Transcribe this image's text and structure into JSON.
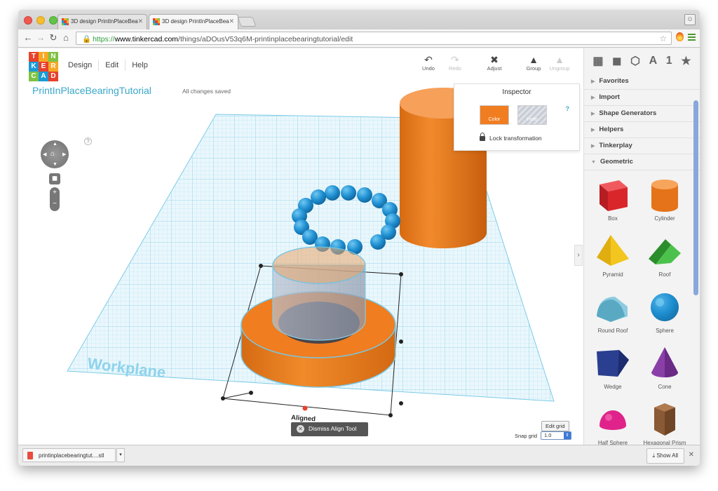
{
  "browser": {
    "tabs": [
      {
        "title": "3D design PrintInPlaceBea"
      },
      {
        "title": "3D design PrintInPlaceBea"
      }
    ],
    "url": {
      "scheme": "https://",
      "host": "www.tinkercad.com",
      "path": "/things/aDOusV53q6M-printinplacebearingtutorial/edit"
    }
  },
  "app": {
    "logo_letters": [
      "T",
      "I",
      "N",
      "K",
      "E",
      "R",
      "C",
      "A",
      "D"
    ],
    "menu": [
      "Design",
      "Edit",
      "Help"
    ],
    "design_title": "PrintInPlaceBearingTutorial",
    "save_status": "All changes saved",
    "tools": {
      "undo": "Undo",
      "redo": "Redo",
      "adjust": "Adjust",
      "group": "Group",
      "ungroup": "Ungroup"
    },
    "right_tab_labels": [
      "A",
      "1"
    ],
    "help_mark": "?"
  },
  "workspace": {
    "workplane_label": "Workplane",
    "align_label": "Aligned",
    "dismiss_label": "Dismiss Align Tool",
    "edit_grid": "Edit grid",
    "snap_label": "Snap grid",
    "snap_value": "1.0"
  },
  "inspector": {
    "title": "Inspector",
    "color_label": "Color",
    "hole_label": "Hole",
    "help": "?",
    "lock_label": "Lock transformation"
  },
  "panel": {
    "sections": [
      "Favorites",
      "Import",
      "Shape Generators",
      "Helpers",
      "Tinkerplay",
      "Geometric"
    ],
    "shapes": [
      {
        "label": "Box",
        "icon": "box-icon",
        "color": "#d9262b"
      },
      {
        "label": "Cylinder",
        "icon": "cylinder-icon",
        "color": "#f07d20"
      },
      {
        "label": "Pyramid",
        "icon": "pyramid-icon",
        "color": "#f2c61f"
      },
      {
        "label": "Roof",
        "icon": "roof-icon",
        "color": "#3bab3b"
      },
      {
        "label": "Round Roof",
        "icon": "round-roof-icon",
        "color": "#6fb6c9"
      },
      {
        "label": "Sphere",
        "icon": "sphere-icon",
        "color": "#1f8fd1"
      },
      {
        "label": "Wedge",
        "icon": "wedge-icon",
        "color": "#2a3f8f"
      },
      {
        "label": "Cone",
        "icon": "cone-icon",
        "color": "#8a3fa8"
      },
      {
        "label": "Half Sphere",
        "icon": "half-sphere-icon",
        "color": "#e0238a"
      },
      {
        "label": "Hexagonal Prism",
        "icon": "hexagonal-prism-icon",
        "color": "#8a5a36"
      }
    ]
  },
  "downloads": {
    "file": "printinplacebearingtut....stl",
    "show_all": "Show All"
  },
  "colors": {
    "accent": "#3aa7c9",
    "object_orange": "#f07d20",
    "ball_blue": "#1f8fd1",
    "grid_blue": "#8fd3ec"
  }
}
